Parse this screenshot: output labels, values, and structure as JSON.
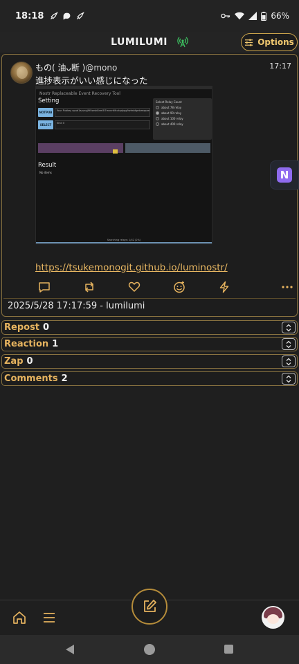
{
  "status_bar": {
    "time": "18:18",
    "notification_icons": [
      "rocket-icon",
      "chat-icon",
      "rocket-icon"
    ],
    "battery": "66%"
  },
  "header": {
    "app_title": "LUMILUMI",
    "options_label": "Options"
  },
  "post": {
    "author_name": "もの( 油ᴗ断 )",
    "author_handle": "@mono",
    "time": "17:17",
    "text": "進捗表示がいい感じになった",
    "link": "https://tsukemonogit.github.io/luminostr/",
    "footer": "2025/5/28 17:17:59 - lumilumi",
    "embedded_screenshot": {
      "title": "Nostr Replaceable Event Recovery Tool",
      "setting_heading": "Setting",
      "button_1": "NOTPUB",
      "field_1_label": "Your Pubkey",
      "field_1": "npub1ayvxyj9f4sesk8nm5l7mvnn6fcutqdypg9wlmkfgetzmqsaesh5slkuwfjwl",
      "button_2": "SELECT",
      "field_2_label": "Kind",
      "field_2": "0",
      "relay_panel_title": "Select Relay Count",
      "relay_options": [
        "about 78 relay",
        "about 90 relay",
        "about 100 relay",
        "about 400 relay"
      ],
      "result_heading": "Result",
      "no_items": "No items",
      "status": "Searching relays: 1/42 (2%)"
    }
  },
  "accordions": [
    {
      "label": "Repost",
      "count": "0"
    },
    {
      "label": "Reaction",
      "count": "1"
    },
    {
      "label": "Zap",
      "count": "0"
    },
    {
      "label": "Comments",
      "count": "2"
    }
  ],
  "floating_badge": {
    "letter": "N"
  },
  "colors": {
    "accent": "#e6b35f",
    "border": "#8a7340",
    "background": "#1f1f1f",
    "link": "#e8b762"
  }
}
